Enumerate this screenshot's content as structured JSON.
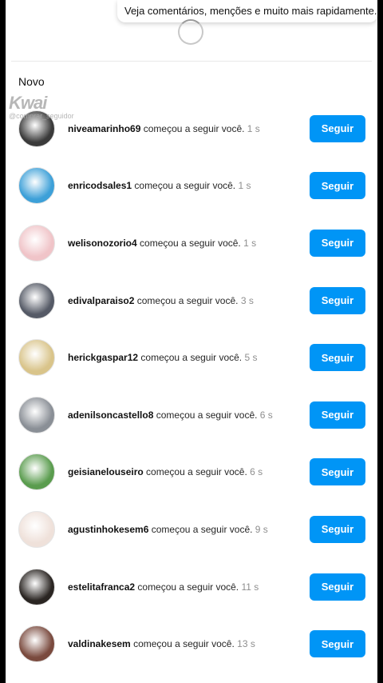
{
  "banner": {
    "text": "Veja comentários, menções e muito mais rapidamente."
  },
  "section": {
    "title": "Novo"
  },
  "watermark": {
    "brand": "Kwai",
    "handle": "@comprar_seguidor"
  },
  "notifications": [
    {
      "username": "nivea­marinho69",
      "action": "começou a seguir você.",
      "time": "1 s",
      "button": "Seguir",
      "avatar_color": "#3a3a3a"
    },
    {
      "username": "enricodsales1",
      "action": "começou a seguir você.",
      "time": "1 s",
      "button": "Seguir",
      "avatar_color": "#3da0d8"
    },
    {
      "username": "welisonozorio4",
      "action": "começou a seguir você.",
      "time": "1 s",
      "button": "Seguir",
      "avatar_color": "#f0c4c8"
    },
    {
      "username": "edivalparaiso2",
      "action": "começou a seguir você.",
      "time": "3 s",
      "button": "Seguir",
      "avatar_color": "#555a66"
    },
    {
      "username": "herickgaspar12",
      "action": "começou a seguir você.",
      "time": "5 s",
      "button": "Seguir",
      "avatar_color": "#d9c48a"
    },
    {
      "username": "adenilsoncastello8",
      "action": "começou a seguir você.",
      "time": "6 s",
      "button": "Seguir",
      "avatar_color": "#8a8f96"
    },
    {
      "username": "geisianelouseiro",
      "action": "começou a seguir você.",
      "time": "6 s",
      "button": "Seguir",
      "avatar_color": "#5a9c4e"
    },
    {
      "username": "agustinhokesem6",
      "action": "começou a seguir você.",
      "time": "9 s",
      "button": "Seguir",
      "avatar_color": "#efe1da"
    },
    {
      "username": "estelitafranca2",
      "action": "começou a seguir você.",
      "time": "11 s",
      "button": "Seguir",
      "avatar_color": "#2a2522"
    },
    {
      "username": "valdinakesem",
      "action": "começou a seguir você.",
      "time": "13 s",
      "button": "Seguir",
      "avatar_color": "#7a4a3e"
    }
  ],
  "colors": {
    "accent": "#0095f6",
    "background": "#ffffff",
    "muted": "#8e8e8e"
  }
}
